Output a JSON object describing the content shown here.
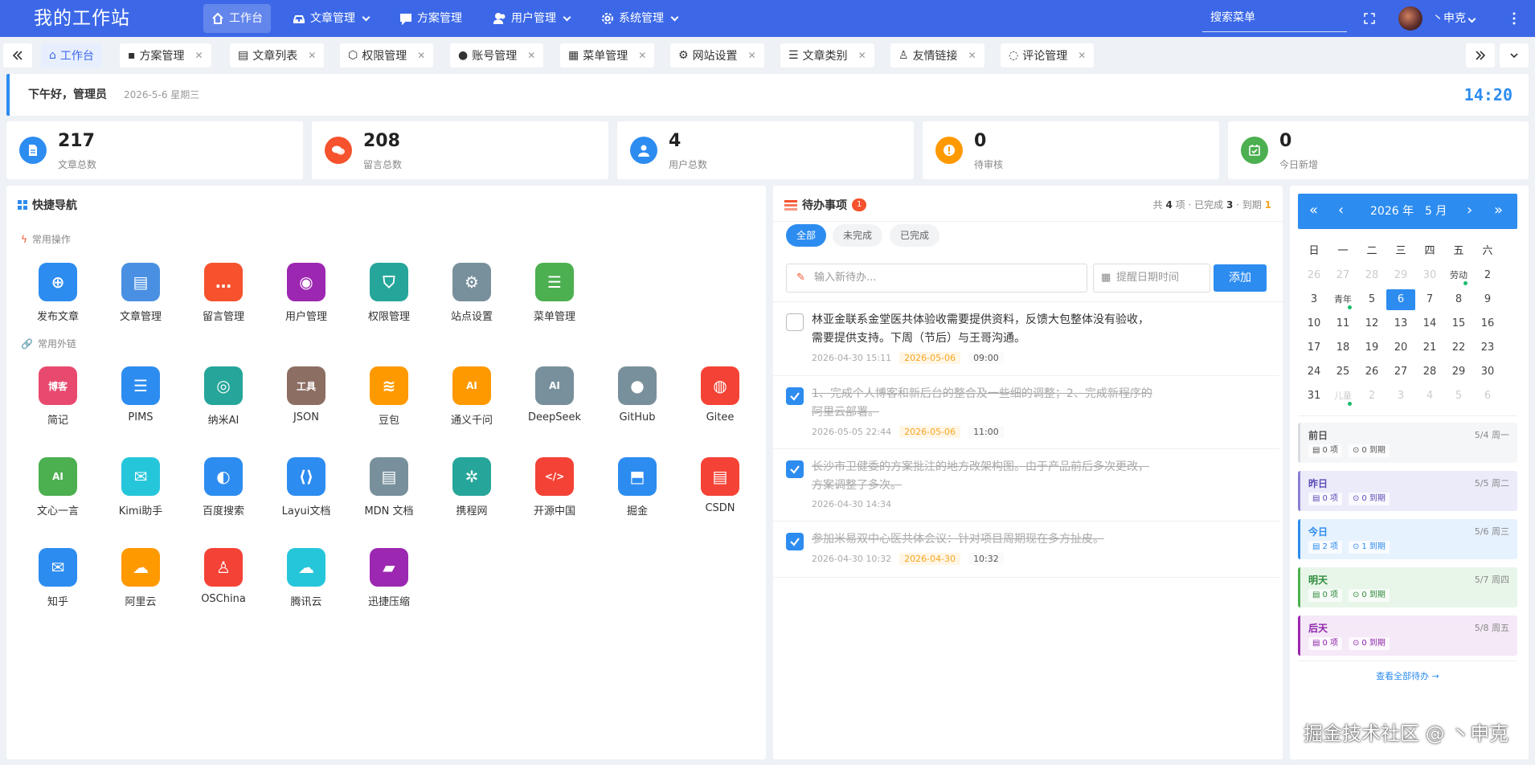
{
  "app": {
    "title": "我的工作站"
  },
  "topnav": [
    {
      "label": "工作台"
    },
    {
      "label": "文章管理"
    },
    {
      "label": "方案管理"
    },
    {
      "label": "用户管理"
    },
    {
      "label": "系统管理"
    }
  ],
  "search": {
    "placeholder": "搜索菜单"
  },
  "user": {
    "name": "丶申克"
  },
  "tabs": [
    {
      "label": "工作台"
    },
    {
      "label": "方案管理"
    },
    {
      "label": "文章列表"
    },
    {
      "label": "权限管理"
    },
    {
      "label": "账号管理"
    },
    {
      "label": "菜单管理"
    },
    {
      "label": "网站设置"
    },
    {
      "label": "文章类别"
    },
    {
      "label": "友情链接"
    },
    {
      "label": "评论管理"
    }
  ],
  "greeting": {
    "text": "下午好，管理员",
    "date": "2026-5-6 星期三",
    "clock": "14:20"
  },
  "stats": [
    {
      "value": "217",
      "label": "文章总数",
      "color": "#2d8cf0"
    },
    {
      "value": "208",
      "label": "留言总数",
      "color": "#f5522d"
    },
    {
      "value": "4",
      "label": "用户总数",
      "color": "#2d8cf0"
    },
    {
      "value": "0",
      "label": "待审核",
      "color": "#ff9900"
    },
    {
      "value": "0",
      "label": "今日新增",
      "color": "#4caf50"
    }
  ],
  "quicknav": {
    "title": "快捷导航",
    "ops_title": "常用操作",
    "ops": [
      {
        "label": "发布文章",
        "color": "#2d8cf0"
      },
      {
        "label": "文章管理",
        "color": "#4a90e2"
      },
      {
        "label": "留言管理",
        "color": "#f5522d"
      },
      {
        "label": "用户管理",
        "color": "#9c27b0"
      },
      {
        "label": "权限管理",
        "color": "#26a69a"
      },
      {
        "label": "站点设置",
        "color": "#78909c"
      },
      {
        "label": "菜单管理",
        "color": "#4caf50"
      }
    ],
    "links_title": "常用外链",
    "links": [
      {
        "label": "简记",
        "color": "#e84a6f",
        "glyph": "博客"
      },
      {
        "label": "PIMS",
        "color": "#2d8cf0",
        "glyph": ""
      },
      {
        "label": "纳米AI",
        "color": "#26a69a",
        "glyph": ""
      },
      {
        "label": "JSON",
        "color": "#8d6e63",
        "glyph": "工具"
      },
      {
        "label": "豆包",
        "color": "#ff9900",
        "glyph": ""
      },
      {
        "label": "通义千问",
        "color": "#ff9900",
        "glyph": "AI"
      },
      {
        "label": "DeepSeek",
        "color": "#78909c",
        "glyph": "AI"
      },
      {
        "label": "GitHub",
        "color": "#78909c",
        "glyph": ""
      },
      {
        "label": "Gitee",
        "color": "#f44336",
        "glyph": ""
      },
      {
        "label": "文心一言",
        "color": "#4caf50",
        "glyph": "AI"
      },
      {
        "label": "Kimi助手",
        "color": "#26c6da",
        "glyph": ""
      },
      {
        "label": "百度搜索",
        "color": "#2d8cf0",
        "glyph": ""
      },
      {
        "label": "Layui文档",
        "color": "#2d8cf0",
        "glyph": ""
      },
      {
        "label": "MDN 文档",
        "color": "#78909c",
        "glyph": ""
      },
      {
        "label": "携程网",
        "color": "#26a69a",
        "glyph": ""
      },
      {
        "label": "开源中国",
        "color": "#f44336",
        "glyph": "</>"
      },
      {
        "label": "掘金",
        "color": "#2d8cf0",
        "glyph": ""
      },
      {
        "label": "CSDN",
        "color": "#f44336",
        "glyph": ""
      },
      {
        "label": "知乎",
        "color": "#2d8cf0",
        "glyph": ""
      },
      {
        "label": "阿里云",
        "color": "#ff9900",
        "glyph": ""
      },
      {
        "label": "OSChina",
        "color": "#f44336",
        "glyph": ""
      },
      {
        "label": "腾讯云",
        "color": "#26c6da",
        "glyph": ""
      },
      {
        "label": "迅捷压缩",
        "color": "#9c27b0",
        "glyph": ""
      }
    ]
  },
  "todo": {
    "title": "待办事项",
    "badge": "1",
    "summary_prefix": "共",
    "total": "4",
    "summary_mid": "项 · 已完成",
    "done": "3",
    "summary_due": "· 到期",
    "due": "1",
    "filters": [
      "全部",
      "未完成",
      "已完成"
    ],
    "input_placeholder": "输入新待办...",
    "date_placeholder": "提醒日期时间",
    "add_label": "添加",
    "items": [
      {
        "text": "林亚金联系金堂医共体验收需要提供资料，反馈大包整体没有验收，需要提供支持。下周（节后）与王哥沟通。",
        "created": "2026-04-30 15:11",
        "due_date": "2026-05-06",
        "due_time": "09:00",
        "done": false
      },
      {
        "text": "1、完成个人博客和新后台的整合及一些细的调整；2、完成新程序的阿里云部署。",
        "created": "2026-05-05 22:44",
        "due_date": "2026-05-06",
        "due_time": "11:00",
        "done": true
      },
      {
        "text": "长沙市卫健委的方案批注的地方改架构图。由于产品前后多次更改，方案调整了多次。",
        "created": "2026-04-30 14:34",
        "due_date": "",
        "due_time": "",
        "done": true
      },
      {
        "text": "参加米易双中心医共体会议：针对项目周期现在多方扯皮。",
        "created": "2026-04-30 10:32",
        "due_date": "2026-04-30",
        "due_time": "10:32",
        "done": true
      }
    ]
  },
  "calendar": {
    "year": "2026 年",
    "month": "5 月",
    "weekdays": [
      "日",
      "一",
      "二",
      "三",
      "四",
      "五",
      "六"
    ],
    "cells": [
      {
        "t": "26",
        "m": true
      },
      {
        "t": "27",
        "m": true
      },
      {
        "t": "28",
        "m": true
      },
      {
        "t": "29",
        "m": true
      },
      {
        "t": "30",
        "m": true
      },
      {
        "t": "劳动",
        "h": true,
        "dot": true
      },
      {
        "t": "2"
      },
      {
        "t": "3"
      },
      {
        "t": "青年",
        "h": true,
        "dot": true
      },
      {
        "t": "5"
      },
      {
        "t": "6",
        "sel": true
      },
      {
        "t": "7"
      },
      {
        "t": "8"
      },
      {
        "t": "9"
      },
      {
        "t": "10"
      },
      {
        "t": "11"
      },
      {
        "t": "12"
      },
      {
        "t": "13"
      },
      {
        "t": "14"
      },
      {
        "t": "15"
      },
      {
        "t": "16"
      },
      {
        "t": "17"
      },
      {
        "t": "18"
      },
      {
        "t": "19"
      },
      {
        "t": "20"
      },
      {
        "t": "21"
      },
      {
        "t": "22"
      },
      {
        "t": "23"
      },
      {
        "t": "24"
      },
      {
        "t": "25"
      },
      {
        "t": "26"
      },
      {
        "t": "27"
      },
      {
        "t": "28"
      },
      {
        "t": "29"
      },
      {
        "t": "30"
      },
      {
        "t": "31"
      },
      {
        "t": "儿童",
        "h": true,
        "m": true,
        "dot": true
      },
      {
        "t": "2",
        "m": true
      },
      {
        "t": "3",
        "m": true
      },
      {
        "t": "4",
        "m": true
      },
      {
        "t": "5",
        "m": true
      },
      {
        "t": "6",
        "m": true
      }
    ],
    "days": [
      {
        "name": "前日",
        "date": "5/4 周一",
        "items": "0 项",
        "due": "0 到期",
        "bg": "#f5f6f8",
        "border": "#d9dde3",
        "fg": "#555"
      },
      {
        "name": "昨日",
        "date": "5/5 周二",
        "items": "0 项",
        "due": "0 到期",
        "bg": "#ecebfa",
        "border": "#8b7fd4",
        "fg": "#5b4bb7"
      },
      {
        "name": "今日",
        "date": "5/6 周三",
        "items": "2 项",
        "due": "1 到期",
        "bg": "#e6f2fd",
        "border": "#2d8cf0",
        "fg": "#2d8cf0"
      },
      {
        "name": "明天",
        "date": "5/7 周四",
        "items": "0 项",
        "due": "0 到期",
        "bg": "#e8f6ea",
        "border": "#4caf50",
        "fg": "#2e8b3a"
      },
      {
        "name": "后天",
        "date": "5/8 周五",
        "items": "0 项",
        "due": "0 到期",
        "bg": "#f5e8f7",
        "border": "#9c27b0",
        "fg": "#8e24aa"
      }
    ],
    "view_all": "查看全部待办 →"
  },
  "watermark": "掘金技术社区 @ 丶申克"
}
